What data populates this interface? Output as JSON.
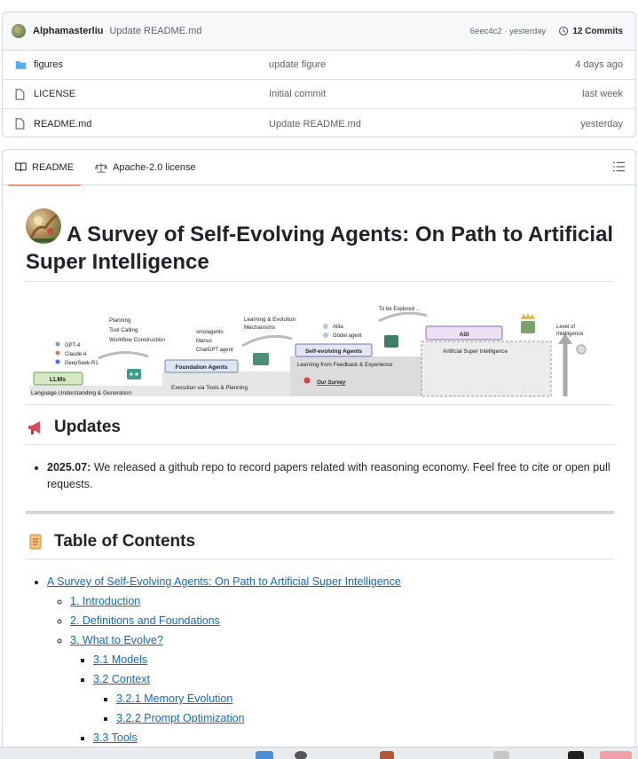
{
  "commit": {
    "author": "Alphamasterliu",
    "message": "Update README.md",
    "hash_time": "6eec4c2 · yesterday",
    "commits_label": "12 Commits"
  },
  "files": [
    {
      "name": "figures",
      "type": "folder",
      "commit": "update figure",
      "date": "4 days ago"
    },
    {
      "name": "LICENSE",
      "type": "file",
      "commit": "Initial commit",
      "date": "last week"
    },
    {
      "name": "README.md",
      "type": "file",
      "commit": "Update README.md",
      "date": "yesterday"
    }
  ],
  "tabs": {
    "readme": "README",
    "license": "Apache-2.0 license"
  },
  "readme": {
    "title": "A Survey of Self-Evolving Agents: On Path to Artificial Super Intelligence",
    "figure": {
      "left_models": [
        "GPT-4",
        "Claude-4",
        "DeepSeek-R1"
      ],
      "llms": "LLMs",
      "lang_stage": "Language Understanding & Generation",
      "planning": [
        "Planning",
        "Tool Calling",
        "Workflow Construction"
      ],
      "foundation": "Foundation Agents",
      "foundation_examples": [
        "smolagents",
        "Manus",
        "ChatGPT agent"
      ],
      "execution": "Execution via Tools & Planning",
      "learning": [
        "Learning & Evolution",
        "Mechanisms"
      ],
      "self_evolving": "Self-evolving Agents",
      "self_examples": [
        "Alita",
        "Gödel agent"
      ],
      "feedback": "Learning from Feedback & Experience",
      "our_survey": "Our Survey",
      "to_explore": "To be Explored ...",
      "asi": "ASI",
      "asi_stage": "Artificial Super Intelligence",
      "level": [
        "Level of",
        "Intelligence"
      ]
    },
    "updates_heading": "Updates",
    "updates": [
      {
        "date": "2025.07:",
        "text": " We released a github repo to record papers related with reasoning economy. Feel free to cite or open pull requests."
      }
    ],
    "toc_heading": "Table of Contents",
    "toc": {
      "root": "A Survey of Self-Evolving Agents: On Path to Artificial Super Intelligence",
      "intro": "1. Introduction",
      "defs": "2. Definitions and Foundations",
      "what": "3. What to Evolve?",
      "models": "3.1 Models",
      "context": "3.2 Context",
      "memory": "3.2.1 Memory Evolution",
      "prompt": "3.2.2 Prompt Optimization",
      "tools": "3.3 Tools"
    }
  },
  "colors": {
    "link": "#0969da",
    "tab_underline": "#fd8c73",
    "folder": "#54aeff"
  }
}
